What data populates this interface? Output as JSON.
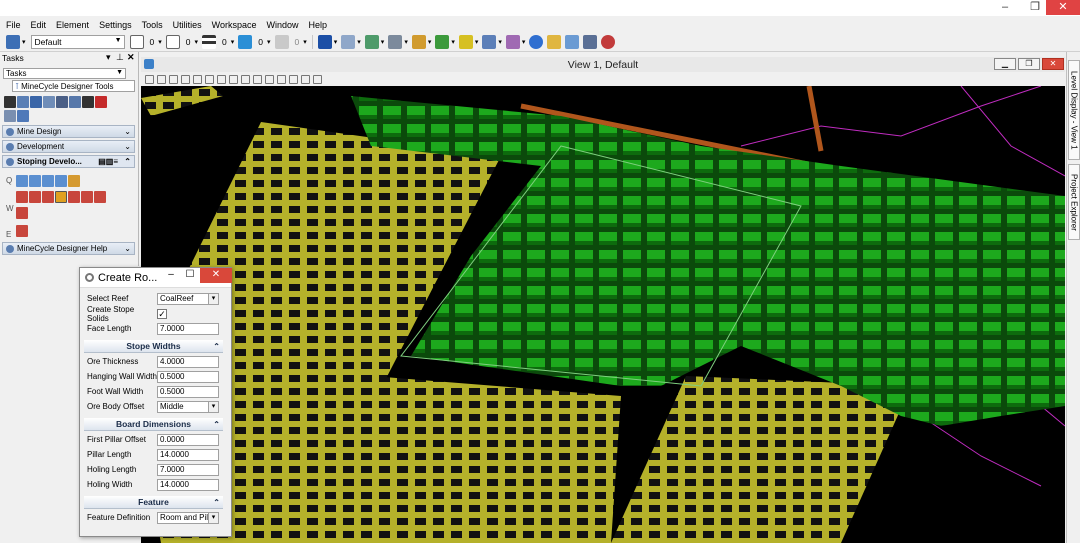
{
  "menu": [
    "File",
    "Edit",
    "Element",
    "Settings",
    "Tools",
    "Utilities",
    "Workspace",
    "Window",
    "Help"
  ],
  "toolbar": {
    "model_combo": "Default",
    "counters": [
      "0",
      "0",
      "0",
      "0",
      "0"
    ]
  },
  "tasks": {
    "header": "Tasks",
    "combo": "Tasks",
    "tools_label": "MineCycle Designer Tools",
    "sections": [
      "Mine Design",
      "Development"
    ],
    "stoping_label": "Stoping Develo...",
    "side_letters": [
      "Q",
      "W",
      "E"
    ],
    "help_section": "MineCycle Designer Help"
  },
  "view": {
    "title": "View 1, Default"
  },
  "dock": {
    "level_display": "Level Display - View 1",
    "project_explorer": "Project Explorer"
  },
  "dialog": {
    "title": "Create Ro...",
    "select_reef": {
      "label": "Select Reef",
      "value": "CoalReef"
    },
    "create_stope": {
      "label": "Create Stope Solids",
      "checked": "✓"
    },
    "face_length": {
      "label": "Face Length",
      "value": "7.0000"
    },
    "stope_widths_title": "Stope Widths",
    "ore_thickness": {
      "label": "Ore Thickness",
      "value": "4.0000"
    },
    "hanging_wall": {
      "label": "Hanging Wall Width",
      "value": "0.5000"
    },
    "foot_wall": {
      "label": "Foot Wall Width",
      "value": "0.5000"
    },
    "ore_offset": {
      "label": "Ore Body Offset",
      "value": "Middle"
    },
    "board_title": "Board Dimensions",
    "first_pillar": {
      "label": "First Pillar Offset",
      "value": "0.0000"
    },
    "pillar_length": {
      "label": "Pillar Length",
      "value": "14.0000"
    },
    "holing_length": {
      "label": "Holing Length",
      "value": "7.0000"
    },
    "holing_width": {
      "label": "Holing Width",
      "value": "14.0000"
    },
    "feature_title": "Feature",
    "feature_def": {
      "label": "Feature Definition",
      "value": "Room and Pill"
    }
  },
  "colors": {
    "pillar_yellow": "#b5b12a",
    "block_green": "#19a319",
    "contour_magenta": "#c02cc0",
    "drive_orange": "#b0561c"
  }
}
